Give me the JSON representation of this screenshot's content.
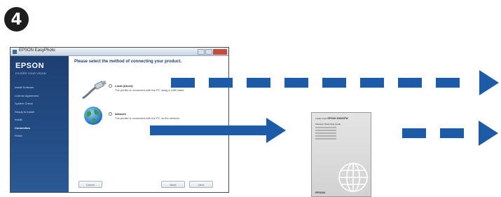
{
  "step": {
    "number": "4"
  },
  "window": {
    "title": "EPSON EasyPhoto",
    "sidebar": {
      "brand": "EPSON",
      "tagline": "EXCEED YOUR VISION",
      "menu": [
        {
          "label": "Install Software",
          "active": false
        },
        {
          "label": "License Agreement",
          "active": false
        },
        {
          "label": "System Check",
          "active": false
        },
        {
          "label": "Ready to Install",
          "active": false
        },
        {
          "label": "Install",
          "active": false
        },
        {
          "label": "Connection",
          "active": true
        },
        {
          "label": "Finish",
          "active": false
        }
      ]
    },
    "heading": "Please select the method of connecting your product.",
    "options": {
      "local": {
        "title": "Local (Direct)",
        "description": "The printer is connected with the PC using a USB cable."
      },
      "network": {
        "title": "Network",
        "description": "The printer is connected with the PC on the network."
      }
    },
    "buttons": {
      "cancel": "Cancel",
      "back": "Back",
      "next": "Next"
    }
  },
  "booklet": {
    "title_prefix": "Install Guide",
    "title_model": "EPSON SX600FW",
    "subtitle": "Wireless Networking Guide",
    "lines": [
      "XXXXXXXXXXXXXXX",
      "XXXXXXXXXXXXXXX",
      "XXXXXXXXXXXXXXX",
      "XXXXXXXXXXXXXXX",
      "XXXXXXXXXXXXXXX"
    ],
    "brand": "EPSON"
  },
  "colors": {
    "arrow": "#1d5aa7",
    "sidebar": "#1d3f72",
    "heading": "#1b3f7a"
  }
}
